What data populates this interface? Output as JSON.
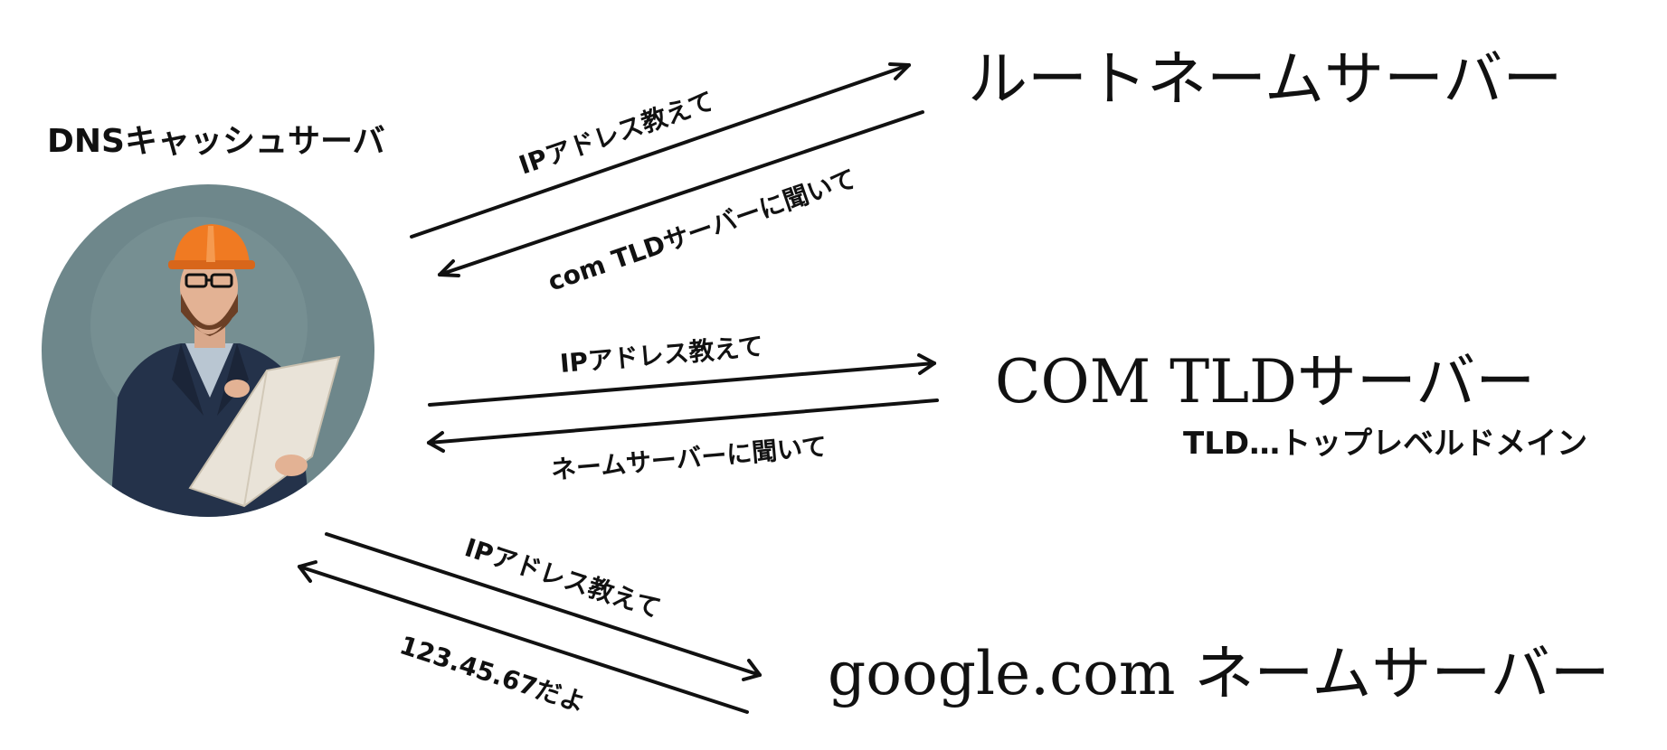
{
  "cache_server": {
    "label": "DNSキャッシュサーバ",
    "avatar_icon": "engineer-with-hardhat-reading-blueprint"
  },
  "servers": {
    "root": "ルートネームサーバー",
    "com_tld": "COM TLDサーバー",
    "tld_note": "TLD…トップレベルドメイン",
    "google": "google.com ネームサーバー"
  },
  "exchanges": [
    {
      "request": "IPアドレス教えて",
      "response": "com TLDサーバーに聞いて"
    },
    {
      "request": "IPアドレス教えて",
      "response": "ネームサーバーに聞いて"
    },
    {
      "request": "IPアドレス教えて",
      "response": "123.45.67だよ"
    }
  ],
  "colors": {
    "ink": "#111111",
    "avatar_background": "#6e878b",
    "hardhat": "#f07a22",
    "suit": "#24324a",
    "paper": "#e9e3d8"
  }
}
